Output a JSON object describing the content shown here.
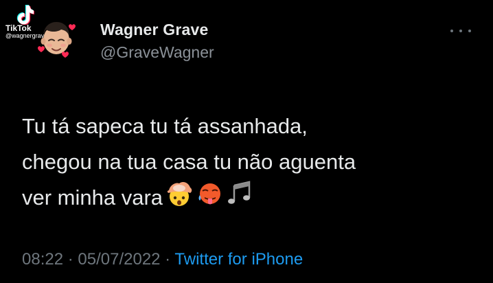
{
  "watermark": {
    "brand": "TikTok",
    "handle": "@wagnergrave"
  },
  "author": {
    "display_name": "Wagner Grave",
    "handle": "@GraveWagner",
    "avatar_icon": "memoji-avatar-with-hearts"
  },
  "tweet": {
    "lines": [
      "Tu tá sapeca tu tá assanhada,",
      "chegou na tua casa tu não aguenta",
      "ver minha vara"
    ],
    "emojis": [
      "exploding-head-emoji",
      "hot-face-emoji",
      "musical-notes-emoji"
    ]
  },
  "meta": {
    "time": "08:22",
    "separator1": " · ",
    "date": "05/07/2022",
    "separator2": " · ",
    "source": "Twitter for iPhone"
  },
  "colors": {
    "background": "#000000",
    "primary_text": "#e7e9ea",
    "secondary_text": "#6e767d",
    "link": "#1d9bf0"
  }
}
